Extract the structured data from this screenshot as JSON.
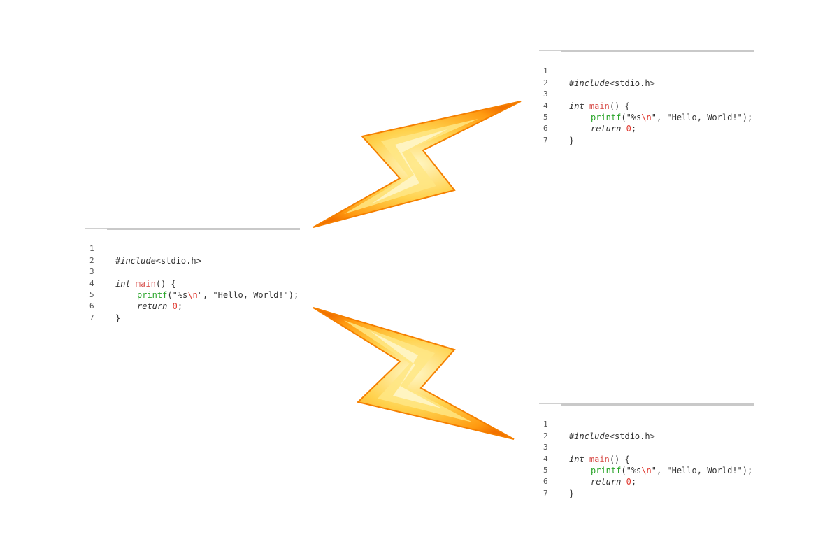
{
  "snippets": [
    {
      "id": "left",
      "line_numbers": [
        "1",
        "2",
        "3",
        "4",
        "5",
        "6",
        "7"
      ],
      "code": {
        "include_kw": "#include",
        "include_hdr": "<stdio.h>",
        "int_kw": "int",
        "main_fn": "main",
        "main_tail": "() {",
        "printf_fn": "printf",
        "printf_open": "(\"%s",
        "printf_esc": "\\n",
        "printf_rest": "\", \"Hello, World!\");",
        "return_kw": "return",
        "return_val": "0",
        "return_tail": ";",
        "close_brace": "}"
      }
    },
    {
      "id": "top-right",
      "line_numbers": [
        "1",
        "2",
        "3",
        "4",
        "5",
        "6",
        "7"
      ],
      "code": {
        "include_kw": "#include",
        "include_hdr": "<stdio.h>",
        "int_kw": "int",
        "main_fn": "main",
        "main_tail": "() {",
        "printf_fn": "printf",
        "printf_open": "(\"%s",
        "printf_esc": "\\n",
        "printf_rest": "\", \"Hello, World!\");",
        "return_kw": "return",
        "return_val": "0",
        "return_tail": ";",
        "close_brace": "}"
      }
    },
    {
      "id": "bottom-right",
      "line_numbers": [
        "1",
        "2",
        "3",
        "4",
        "5",
        "6",
        "7"
      ],
      "code": {
        "include_kw": "#include",
        "include_hdr": "<stdio.h>",
        "int_kw": "int",
        "main_fn": "main",
        "main_tail": "() {",
        "printf_fn": "printf",
        "printf_open": "(\"%s",
        "printf_esc": "\\n",
        "printf_rest": "\", \"Hello, World!\");",
        "return_kw": "return",
        "return_val": "0",
        "return_tail": ";",
        "close_brace": "}"
      }
    }
  ],
  "colors": {
    "bolt_outer": "#f57f00",
    "bolt_mid": "#ffb52e",
    "bolt_inner": "#fff3b8",
    "function_name": "#d9534f",
    "call_name": "#2aa52a",
    "escape": "#e0392f"
  },
  "icons": [
    "lightning-bolt-icon",
    "lightning-bolt-icon"
  ]
}
